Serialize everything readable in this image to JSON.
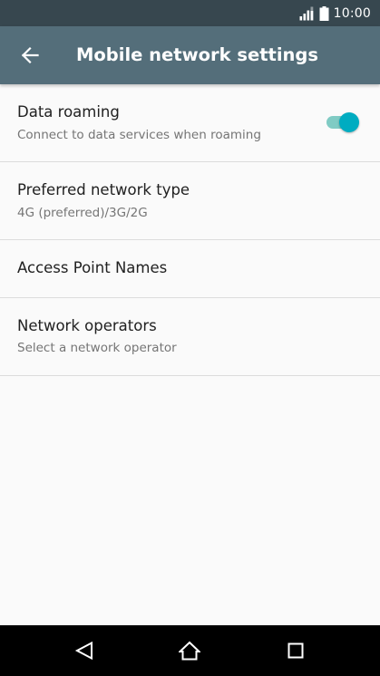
{
  "status_bar": {
    "time": "10:00",
    "icons": [
      "signal-icon",
      "battery-icon"
    ]
  },
  "app_bar": {
    "title": "Mobile network settings",
    "back_icon": "arrow-back-icon"
  },
  "settings": [
    {
      "title": "Data roaming",
      "summary": "Connect to data services when roaming",
      "toggle_on": true
    },
    {
      "title": "Preferred network type",
      "summary": "4G (preferred)/3G/2G"
    },
    {
      "title": "Access Point Names"
    },
    {
      "title": "Network operators",
      "summary": "Select a network operator"
    }
  ],
  "nav_bar": {
    "icons": [
      "back-triangle-icon",
      "home-icon",
      "recents-icon"
    ]
  },
  "colors": {
    "status_bar": "#37474f",
    "app_bar": "#546e7a",
    "background": "#fafafa",
    "accent": "#00acc1",
    "toggle_track": "#80cbc4",
    "divider": "#dcdcdc",
    "title_text": "#212121",
    "summary_text": "#757575"
  }
}
